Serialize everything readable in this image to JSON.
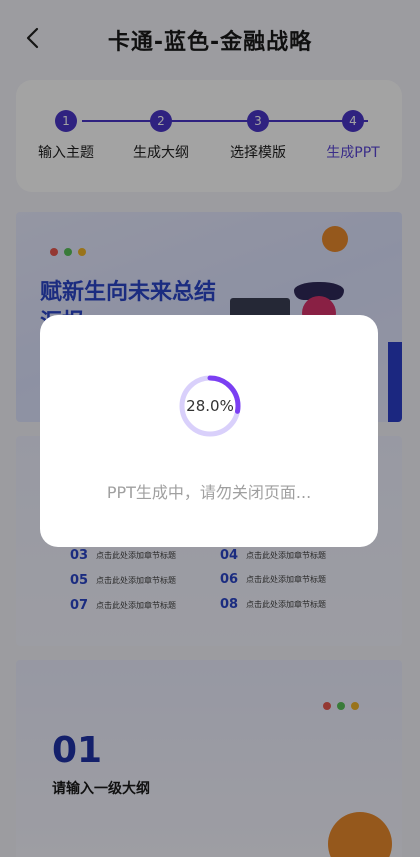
{
  "header": {
    "title": "卡通-蓝色-金融战略",
    "back_icon": "chevron-left-icon"
  },
  "steps": [
    {
      "num": "1",
      "label": "输入主题"
    },
    {
      "num": "2",
      "label": "生成大纲"
    },
    {
      "num": "3",
      "label": "选择模版"
    },
    {
      "num": "4",
      "label": "生成PPT"
    }
  ],
  "active_step": 4,
  "slides": {
    "cover": {
      "title": "赋新生向未来总结汇报"
    },
    "outline": {
      "items": [
        {
          "num": "03",
          "text": "点击此处添加章节标题"
        },
        {
          "num": "04",
          "text": "点击此处添加章节标题"
        },
        {
          "num": "05",
          "text": "点击此处添加章节标题"
        },
        {
          "num": "06",
          "text": "点击此处添加章节标题"
        },
        {
          "num": "07",
          "text": "点击此处添加章节标题"
        },
        {
          "num": "08",
          "text": "点击此处添加章节标题"
        }
      ]
    },
    "section": {
      "num": "01",
      "label": "请输入一级大纲"
    }
  },
  "modal": {
    "progress_text": "28.0%",
    "progress": 0.28,
    "message": "PPT生成中，请勿关闭页面..."
  },
  "colors": {
    "accent": "#4a36c9",
    "slide_blue": "#2b46c9",
    "progress": "#7b3ff2"
  }
}
